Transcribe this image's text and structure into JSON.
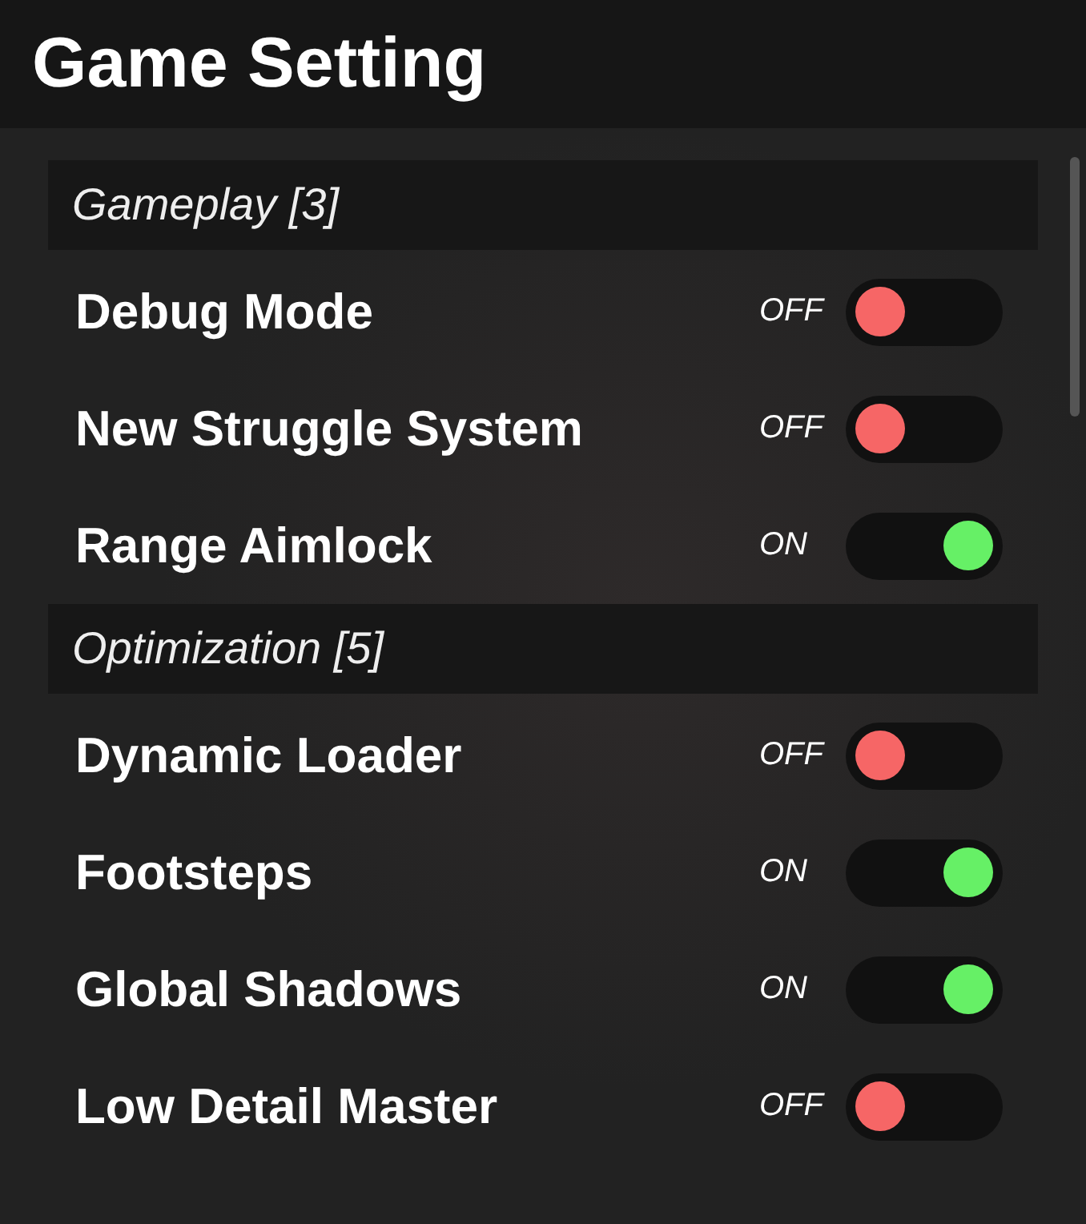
{
  "window": {
    "title": "Game Setting"
  },
  "sections": [
    {
      "title": "Gameplay [3]",
      "settings": [
        {
          "label": "Debug Mode",
          "state_text": "OFF",
          "on": false
        },
        {
          "label": "New Struggle System",
          "state_text": "OFF",
          "on": false
        },
        {
          "label": "Range Aimlock",
          "state_text": "ON",
          "on": true
        }
      ]
    },
    {
      "title": "Optimization [5]",
      "settings": [
        {
          "label": "Dynamic Loader",
          "state_text": "OFF",
          "on": false
        },
        {
          "label": "Footsteps",
          "state_text": "ON",
          "on": true
        },
        {
          "label": "Global Shadows",
          "state_text": "ON",
          "on": true
        },
        {
          "label": "Low Detail Master",
          "state_text": "OFF",
          "on": false
        }
      ]
    }
  ]
}
